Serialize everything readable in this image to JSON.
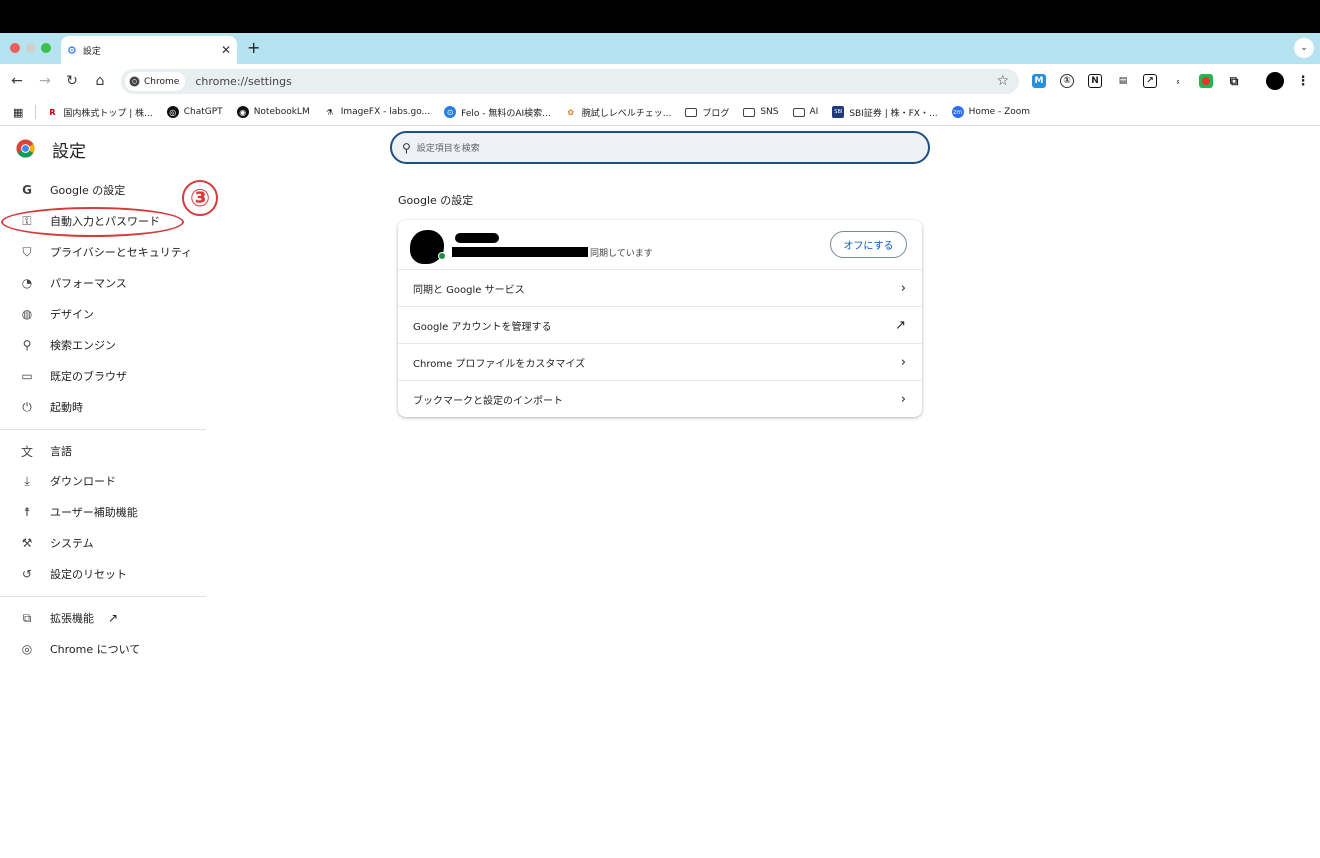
{
  "browser": {
    "tab_title": "設定",
    "new_tab_label": "+",
    "chip_label": "Chrome",
    "url": "chrome://settings"
  },
  "bookmarks": [
    {
      "label": "国内株式トップ | 株...",
      "icon": "R"
    },
    {
      "label": "ChatGPT",
      "icon": "◎"
    },
    {
      "label": "NotebookLM",
      "icon": "◉"
    },
    {
      "label": "ImageFX - labs.go...",
      "icon": "⚗"
    },
    {
      "label": "Felo - 無料のAI検索...",
      "icon": "⊙"
    },
    {
      "label": "腕試しレベルチェッ...",
      "icon": "✿"
    },
    {
      "label": "ブログ",
      "icon": "folder"
    },
    {
      "label": "SNS",
      "icon": "folder"
    },
    {
      "label": "AI",
      "icon": "folder"
    },
    {
      "label": "SBI証券 | 株・FX・...",
      "icon": "SBI"
    },
    {
      "label": "Home - Zoom",
      "icon": "zm"
    }
  ],
  "settings": {
    "title": "設定",
    "search_placeholder": "設定項目を検索",
    "nav": [
      {
        "label": "Google の設定",
        "icon": "google-icon"
      },
      {
        "label": "自動入力とパスワード",
        "icon": "key-icon"
      },
      {
        "label": "プライバシーとセキュリティ",
        "icon": "shield-icon"
      },
      {
        "label": "パフォーマンス",
        "icon": "speedometer-icon"
      },
      {
        "label": "デザイン",
        "icon": "palette-icon"
      },
      {
        "label": "検索エンジン",
        "icon": "search-icon"
      },
      {
        "label": "既定のブラウザ",
        "icon": "browser-icon"
      },
      {
        "label": "起動時",
        "icon": "power-icon"
      },
      {
        "label": "言語",
        "icon": "translate-icon"
      },
      {
        "label": "ダウンロード",
        "icon": "download-icon"
      },
      {
        "label": "ユーザー補助機能",
        "icon": "accessibility-icon"
      },
      {
        "label": "システム",
        "icon": "wrench-icon"
      },
      {
        "label": "設定のリセット",
        "icon": "reset-icon"
      },
      {
        "label": "拡張機能",
        "icon": "puzzle-icon"
      },
      {
        "label": "Chrome について",
        "icon": "chrome-icon"
      }
    ],
    "annotation_number": "③",
    "section_title": "Google の設定",
    "account": {
      "sync_text": "同期しています",
      "off_button": "オフにする"
    },
    "rows": [
      {
        "label": "同期と Google サービス",
        "icon": "chevron-right-icon"
      },
      {
        "label": "Google アカウントを管理する",
        "icon": "external-link-icon"
      },
      {
        "label": "Chrome プロファイルをカスタマイズ",
        "icon": "chevron-right-icon"
      },
      {
        "label": "ブックマークと設定のインポート",
        "icon": "chevron-right-icon"
      }
    ]
  },
  "colors": {
    "tabbar": "#b5e3ef",
    "accent": "#0b57d0",
    "annotation": "#d43b3b"
  }
}
